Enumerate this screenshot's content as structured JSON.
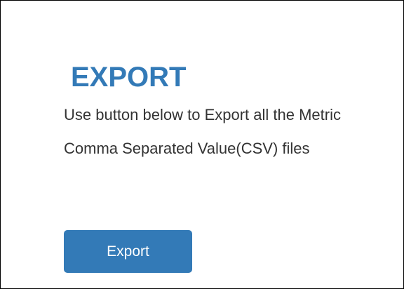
{
  "panel": {
    "title": "EXPORT",
    "description": "Use button below to Export all the Metric Comma Separated Value(CSV) files",
    "export_button_label": "Export"
  },
  "colors": {
    "accent": "#337ab7",
    "text": "#333333",
    "background": "#ffffff",
    "border": "#000000"
  }
}
